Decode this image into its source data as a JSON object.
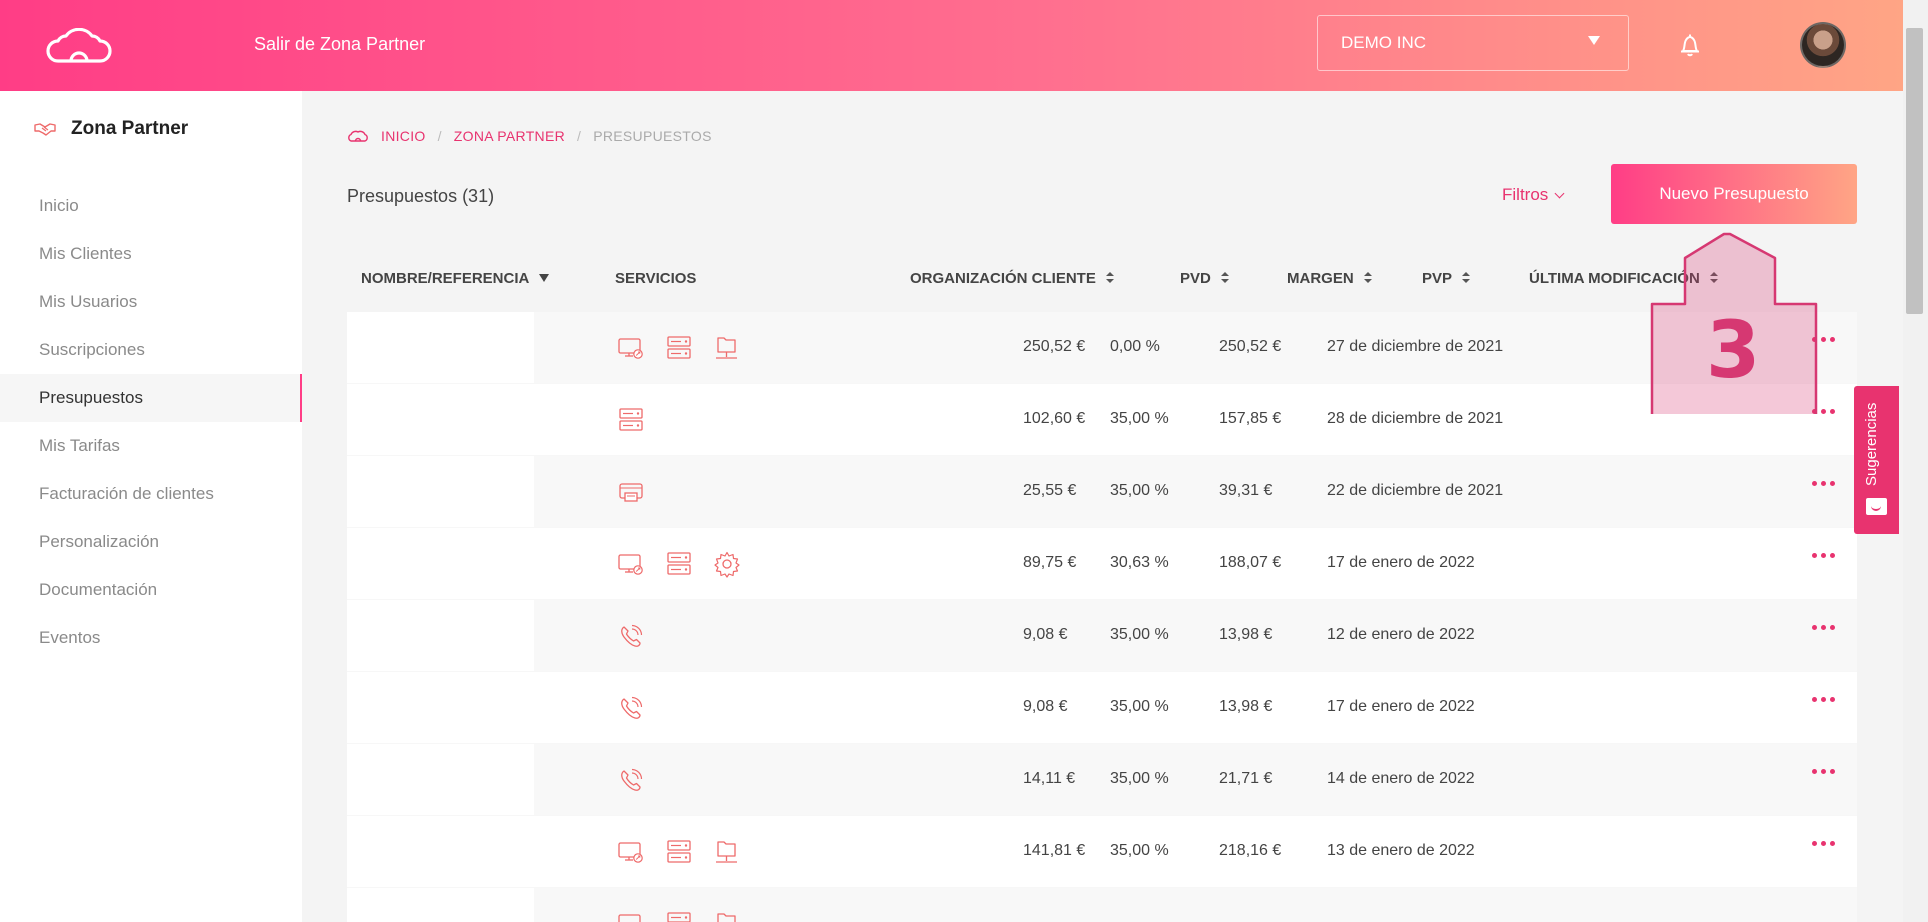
{
  "header": {
    "exit_label": "Salir de Zona Partner",
    "org_value": "DEMO INC"
  },
  "sidebar": {
    "title": "Zona Partner",
    "items": [
      {
        "label": "Inicio"
      },
      {
        "label": "Mis Clientes"
      },
      {
        "label": "Mis Usuarios"
      },
      {
        "label": "Suscripciones"
      },
      {
        "label": "Presupuestos",
        "active": true
      },
      {
        "label": "Mis Tarifas"
      },
      {
        "label": "Facturación de clientes"
      },
      {
        "label": "Personalización"
      },
      {
        "label": "Documentación"
      },
      {
        "label": "Eventos"
      }
    ]
  },
  "breadcrumb": {
    "items": [
      "INICIO",
      "ZONA PARTNER",
      "PRESUPUESTOS"
    ],
    "separator": "/"
  },
  "page": {
    "title": "Presupuestos (31)",
    "filters_label": "Filtros",
    "new_button": "Nuevo Presupuesto"
  },
  "table": {
    "columns": {
      "name": "NOMBRE/REFERENCIA",
      "services": "SERVICIOS",
      "org": "ORGANIZACIÓN CLIENTE",
      "pvd": "PVD",
      "margin": "MARGEN",
      "pvp": "PVP",
      "modified": "ÚLTIMA MODIFICACIÓN"
    },
    "rows": [
      {
        "services": [
          "pc-icon",
          "server-icon",
          "folder-network-icon"
        ],
        "pvd": "250,52 €",
        "margin": "0,00 %",
        "pvp": "250,52 €",
        "modified": "27 de diciembre de 2021"
      },
      {
        "services": [
          "server-icon"
        ],
        "pvd": "102,60 €",
        "margin": "35,00 %",
        "pvp": "157,85 €",
        "modified": "28 de diciembre de 2021"
      },
      {
        "services": [
          "printer-icon"
        ],
        "pvd": "25,55 €",
        "margin": "35,00 %",
        "pvp": "39,31 €",
        "modified": "22 de diciembre de 2021"
      },
      {
        "services": [
          "pc-icon",
          "server-icon",
          "gear-icon"
        ],
        "pvd": "89,75 €",
        "margin": "30,63 %",
        "pvp": "188,07 €",
        "modified": "17 de enero de 2022"
      },
      {
        "services": [
          "phone-icon"
        ],
        "pvd": "9,08 €",
        "margin": "35,00 %",
        "pvp": "13,98 €",
        "modified": "12 de enero de 2022"
      },
      {
        "services": [
          "phone-icon"
        ],
        "pvd": "9,08 €",
        "margin": "35,00 %",
        "pvp": "13,98 €",
        "modified": "17 de enero de 2022"
      },
      {
        "services": [
          "phone-icon"
        ],
        "pvd": "14,11 €",
        "margin": "35,00 %",
        "pvp": "21,71 €",
        "modified": "14 de enero de 2022"
      },
      {
        "services": [
          "pc-icon",
          "server-icon",
          "folder-network-icon"
        ],
        "pvd": "141,81 €",
        "margin": "35,00 %",
        "pvp": "218,16 €",
        "modified": "13 de enero de 2022"
      },
      {
        "services": [
          "pc-icon",
          "server-icon",
          "folder-network-icon"
        ],
        "pvd": "",
        "margin": "",
        "pvp": "",
        "modified": ""
      }
    ]
  },
  "suggestions_tab": {
    "label": "Sugerencias"
  },
  "annotation": {
    "number": "3"
  },
  "colors": {
    "accent": "#e8336f",
    "gradient_start": "#ff3d86",
    "gradient_end": "#ffa585",
    "icon_stroke": "#ee6a6a"
  }
}
